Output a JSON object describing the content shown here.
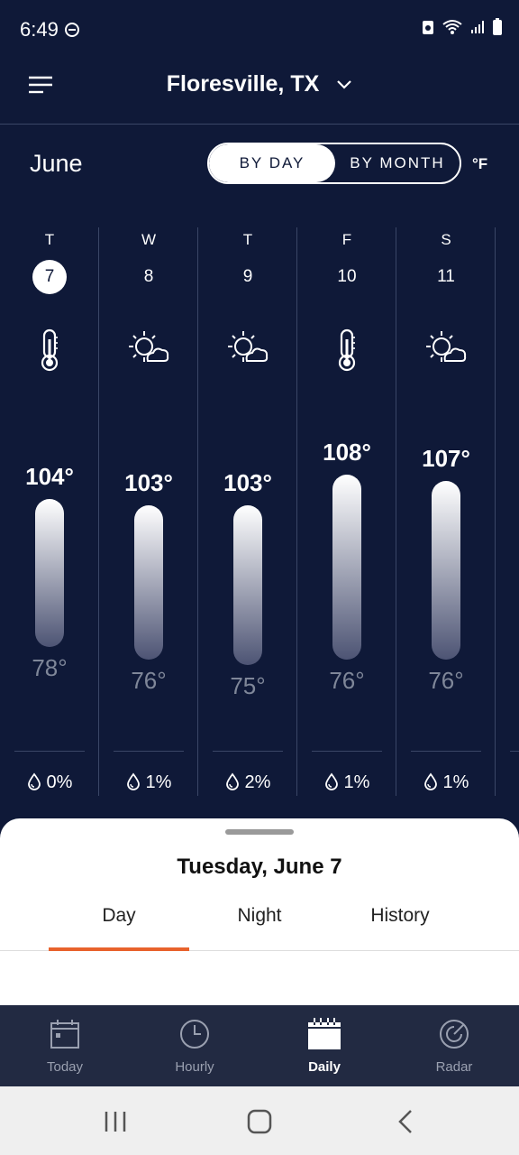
{
  "status": {
    "time": "6:49"
  },
  "header": {
    "location": "Floresville, TX"
  },
  "controls": {
    "month": "June",
    "by_day": "BY DAY",
    "by_month": "BY MONTH",
    "unit": "°F"
  },
  "days": [
    {
      "dow": "T",
      "date": "7",
      "icon": "thermometer-icon",
      "high": "104°",
      "low": "78°",
      "high_value": 104,
      "low_value": 78,
      "precip": "0%"
    },
    {
      "dow": "W",
      "date": "8",
      "icon": "partly-cloudy-icon",
      "high": "103°",
      "low": "76°",
      "high_value": 103,
      "low_value": 76,
      "precip": "1%"
    },
    {
      "dow": "T",
      "date": "9",
      "icon": "partly-cloudy-icon",
      "high": "103°",
      "low": "75°",
      "high_value": 103,
      "low_value": 75,
      "precip": "2%"
    },
    {
      "dow": "F",
      "date": "10",
      "icon": "thermometer-icon",
      "high": "108°",
      "low": "76°",
      "high_value": 108,
      "low_value": 76,
      "precip": "1%"
    },
    {
      "dow": "S",
      "date": "11",
      "icon": "partly-cloudy-icon",
      "high": "107°",
      "low": "76°",
      "high_value": 107,
      "low_value": 76,
      "precip": "1%"
    }
  ],
  "sheet": {
    "title": "Tuesday, June 7",
    "tabs": [
      "Day",
      "Night",
      "History"
    ],
    "active_tab": "Day"
  },
  "nav": {
    "items": [
      {
        "label": "Today",
        "icon": "calendar-today-icon"
      },
      {
        "label": "Hourly",
        "icon": "clock-icon"
      },
      {
        "label": "Daily",
        "icon": "calendar-daily-icon"
      },
      {
        "label": "Radar",
        "icon": "radar-icon"
      }
    ],
    "active": "Daily"
  },
  "colors": {
    "background": "#0f1938",
    "accent": "#e8622c",
    "nav_bg": "#222a42"
  }
}
